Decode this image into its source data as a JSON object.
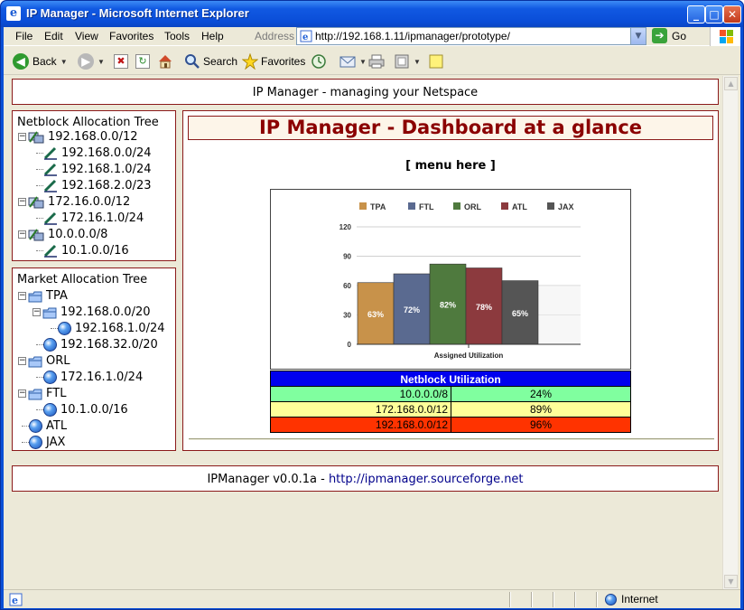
{
  "window": {
    "title": "IP Manager - Microsoft Internet Explorer",
    "controls": [
      "_",
      "□",
      "✕"
    ]
  },
  "menubar": {
    "items": [
      "File",
      "Edit",
      "View",
      "Favorites",
      "Tools",
      "Help"
    ],
    "address_label": "Address",
    "address_value": "http://192.168.1.11/ipmanager/prototype/",
    "go_label": "Go"
  },
  "toolbar": {
    "back_label": "Back",
    "search_label": "Search",
    "favorites_label": "Favorites"
  },
  "page": {
    "header": "IP Manager - managing your Netspace",
    "netblock_tree": {
      "title": "Netblock Allocation Tree",
      "nodes": [
        "192.168.0.0/12",
        "192.168.0.0/24",
        "192.168.1.0/24",
        "192.168.2.0/23",
        "172.16.0.0/12",
        "172.16.1.0/24",
        "10.0.0.0/8",
        "10.1.0.0/16"
      ]
    },
    "market_tree": {
      "title": "Market Allocation Tree",
      "nodes": [
        "TPA",
        "192.168.0.0/20",
        "192.168.1.0/24",
        "192.168.32.0/20",
        "ORL",
        "172.16.1.0/24",
        "FTL",
        "10.1.0.0/16",
        "ATL",
        "JAX"
      ]
    },
    "dashboard_title": "IP Manager - Dashboard at a glance",
    "menu_placeholder": "[ menu here ]",
    "util_table": {
      "title": "Netblock Utilization",
      "rows": [
        {
          "netblock": "10.0.0.0/8",
          "utilization": "24%",
          "color": "#80ff9f"
        },
        {
          "netblock": "172.168.0.0/12",
          "utilization": "89%",
          "color": "#ffff99"
        },
        {
          "netblock": "192.168.0.0/12",
          "utilization": "96%",
          "color": "#ff3300"
        }
      ]
    },
    "footer_prefix": "IPManager v0.0.1a - ",
    "footer_link": "http://ipmanager.sourceforge.net"
  },
  "statusbar": {
    "zone": "Internet"
  },
  "chart_data": {
    "type": "bar",
    "categories": [
      "TPA",
      "FTL",
      "ORL",
      "ATL",
      "JAX"
    ],
    "values": [
      63,
      72,
      82,
      78,
      65
    ],
    "data_labels": [
      "63%",
      "72%",
      "82%",
      "78%",
      "65%"
    ],
    "colors": [
      "#c8924a",
      "#5a6a90",
      "#4f7a3e",
      "#8c3a3e",
      "#555555"
    ],
    "xlabel": "Assigned Utilization",
    "ylabel": "",
    "ylim": [
      0,
      120
    ],
    "yticks": [
      0,
      30,
      60,
      90,
      120
    ],
    "legend": "top",
    "grid": true
  }
}
